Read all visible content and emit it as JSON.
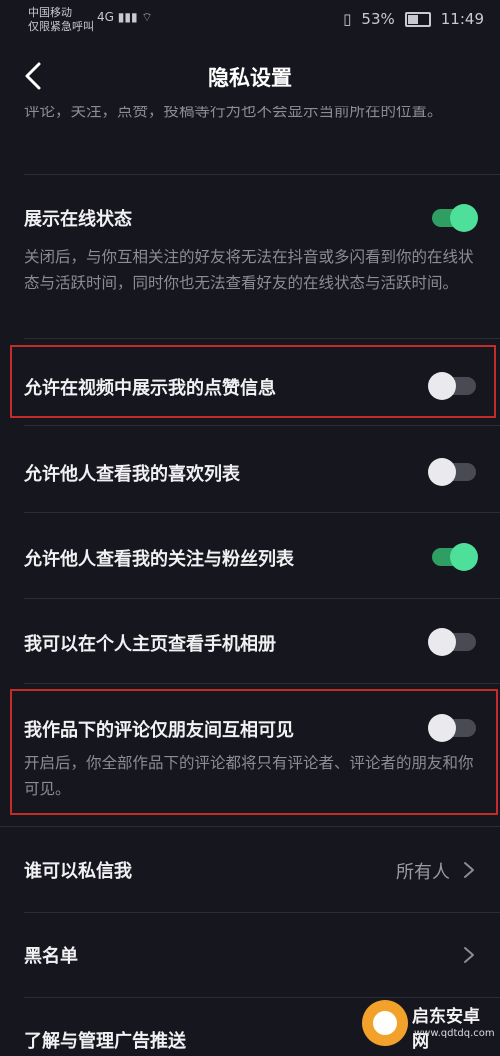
{
  "status_bar": {
    "carrier_line1": "中国移动",
    "carrier_line2": "仅限紧急呼叫",
    "signal": "4G ▮▮▮ ⌔",
    "vibrate": "▯",
    "battery_pct": "53%",
    "time": "11:49"
  },
  "nav": {
    "title": "隐私设置"
  },
  "top_cut_text": "评论，关注，点赞，投稿等行为也不会显示当前所在的位置。",
  "settings": [
    {
      "title": "展示在线状态",
      "on": true,
      "desc": "关闭后，与你互相关注的好友将无法在抖音或多闪看到你的在线状态与活跃时间，同时你也无法查看好友的在线状态与活跃时间。"
    },
    {
      "title": "允许在视频中展示我的点赞信息",
      "on": false
    },
    {
      "title": "允许他人查看我的喜欢列表",
      "on": false
    },
    {
      "title": "允许他人查看我的关注与粉丝列表",
      "on": true
    },
    {
      "title": "我可以在个人主页查看手机相册",
      "on": false
    },
    {
      "title": "我作品下的评论仅朋友间互相可见",
      "on": false,
      "desc": "开启后，你全部作品下的评论都将只有评论者、评论者的朋友和你可见。"
    }
  ],
  "links": [
    {
      "title": "谁可以私信我",
      "value": "所有人"
    },
    {
      "title": "黑名单",
      "value": ""
    },
    {
      "title": "了解与管理广告推送",
      "value": ""
    }
  ],
  "colors": {
    "background": "#16161f",
    "toggle_on": "#4ee09a",
    "highlight": "#c42c2c"
  },
  "watermark": {
    "name": "启东安卓网",
    "url": "www.qdtdq.com"
  }
}
